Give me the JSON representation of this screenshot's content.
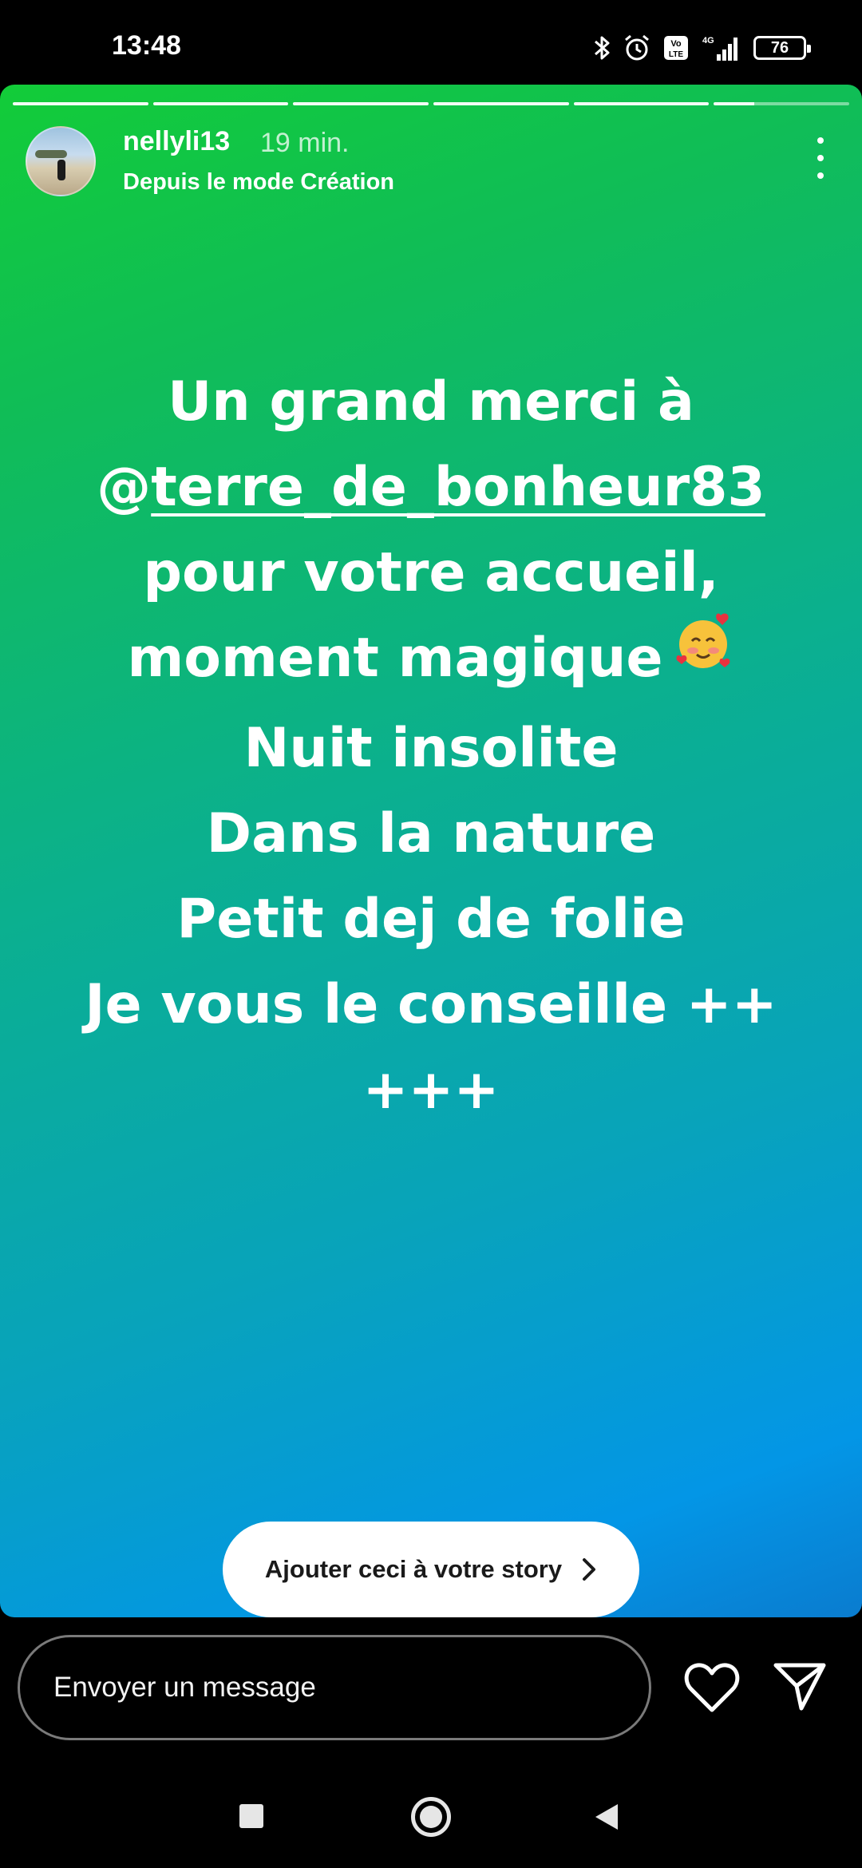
{
  "status_bar": {
    "time": "13:48",
    "battery": "76",
    "icons": [
      "bluetooth-icon",
      "alarm-icon",
      "volte-icon",
      "signal-4g-icon",
      "battery-icon"
    ]
  },
  "story": {
    "username": "nellyli13",
    "time_ago": "19 min.",
    "subtitle": "Depuis le mode Création",
    "background": {
      "gradient_start": "#12cc38",
      "gradient_end": "#0396e6"
    },
    "text": {
      "line1": "Un grand merci à",
      "mention_prefix": "@",
      "mention": "terre_de_bonheur83",
      "line3": "pour votre accueil,",
      "line4": "moment magique",
      "emoji": "smiling-face-with-hearts-emoji",
      "line5": "Nuit insolite",
      "line6": "Dans la nature",
      "line7": "Petit dej de folie",
      "line8": "Je vous le conseille ++",
      "line9": "+++"
    },
    "add_button": "Ajouter ceci à votre story"
  },
  "reply_bar": {
    "placeholder": "Envoyer un message",
    "icons": [
      "heart-icon",
      "send-icon"
    ]
  },
  "nav_bar": {
    "icons": [
      "recents-square-icon",
      "home-circle-icon",
      "back-triangle-icon"
    ]
  }
}
